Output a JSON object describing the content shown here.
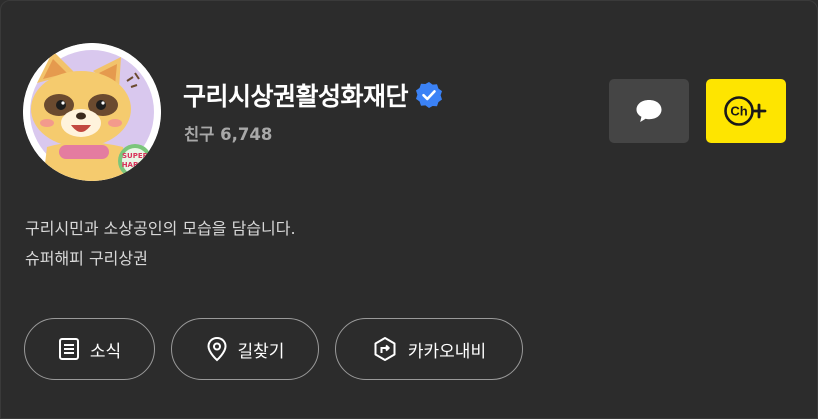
{
  "profile": {
    "name": "구리시상권활성화재단",
    "friends_label": "친구 6,748",
    "avatar_text": "SUPER HAPPY",
    "verified_icon": "verified-badge-icon"
  },
  "description": {
    "line1": "구리시민과 소상공인의 모습을 담습니다.",
    "line2": "슈퍼해피 구리상권"
  },
  "buttons": {
    "chat_icon": "speech-bubble-icon",
    "channel_add_label": "Ch",
    "channel_add_icon": "plus-icon"
  },
  "actions": [
    {
      "label": "소식",
      "icon": "news-list-icon"
    },
    {
      "label": "길찾기",
      "icon": "location-pin-icon"
    },
    {
      "label": "카카오내비",
      "icon": "navi-turn-icon"
    }
  ],
  "colors": {
    "background": "#2c2c2c",
    "accent_yellow": "#fee500",
    "verified_blue": "#3b82f6",
    "secondary_text": "#a8a8a8"
  }
}
